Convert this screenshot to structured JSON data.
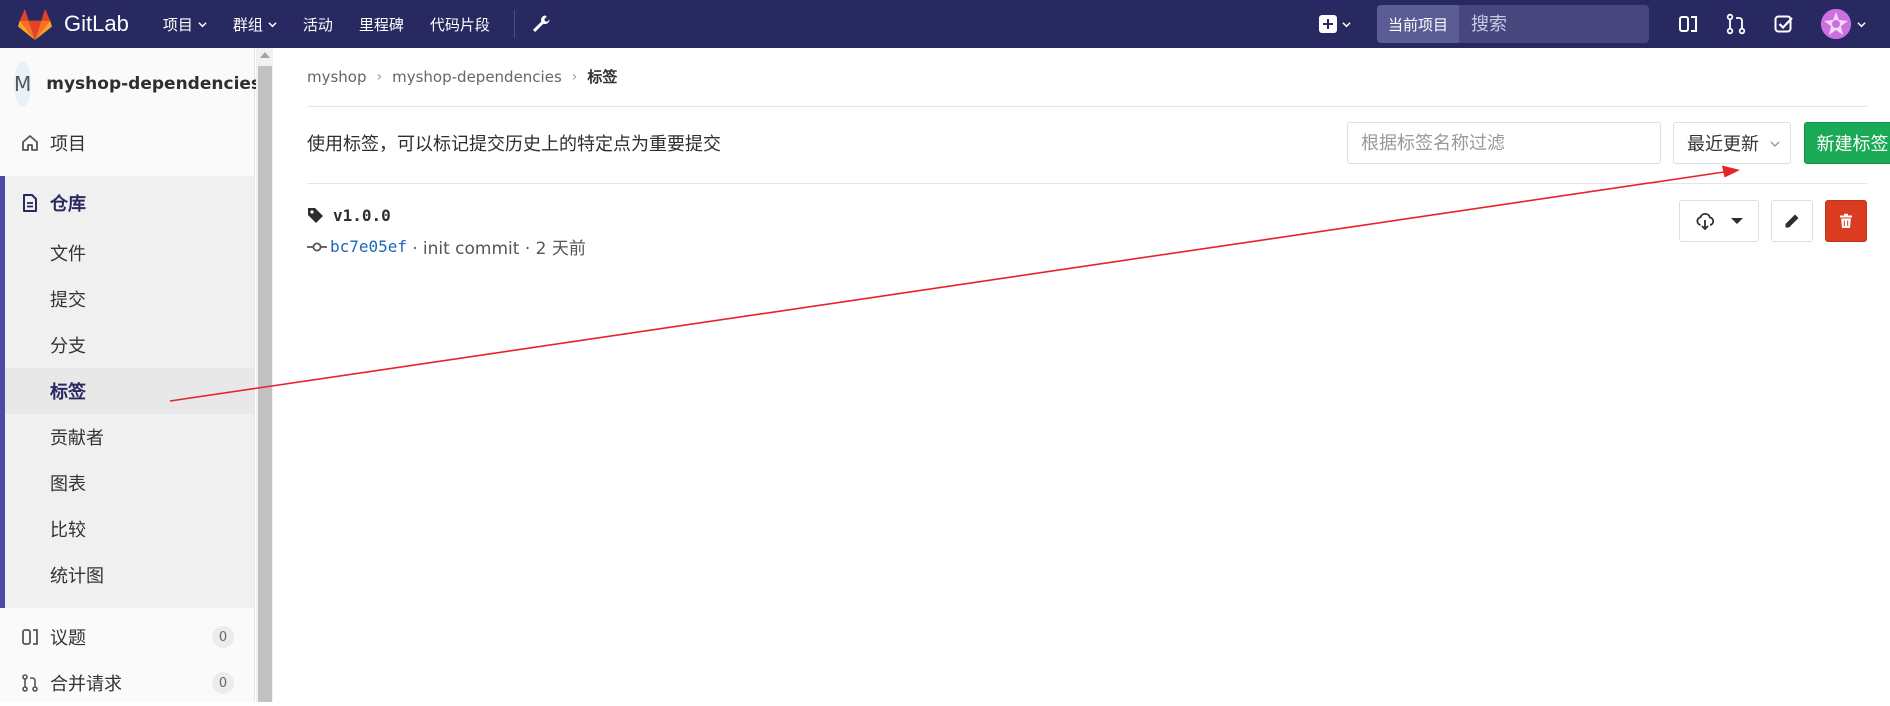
{
  "navbar": {
    "brand": "GitLab",
    "links": [
      {
        "label": "项目",
        "dropdown": true
      },
      {
        "label": "群组",
        "dropdown": true
      },
      {
        "label": "活动",
        "dropdown": false
      },
      {
        "label": "里程碑",
        "dropdown": false
      },
      {
        "label": "代码片段",
        "dropdown": false
      }
    ],
    "search_scope": "当前项目",
    "search_placeholder": "搜索"
  },
  "sidebar": {
    "project_initial": "M",
    "project_name": "myshop-dependencies",
    "project_label": "项目",
    "repo_label": "仓库",
    "repo_items": [
      "文件",
      "提交",
      "分支",
      "标签",
      "贡献者",
      "图表",
      "比较",
      "统计图"
    ],
    "active_item": "标签",
    "issues_label": "议题",
    "issues_count": "0",
    "mr_label": "合并请求",
    "mr_count": "0"
  },
  "breadcrumb": {
    "items": [
      "myshop",
      "myshop-dependencies"
    ],
    "current": "标签"
  },
  "main": {
    "description": "使用标签，可以标记提交历史上的特定点为重要提交",
    "filter_placeholder": "根据标签名称过滤",
    "sort_label": "最近更新",
    "new_tag_button": "新建标签"
  },
  "tags": [
    {
      "name": "v1.0.0",
      "sha": "bc7e05ef",
      "message": "· init commit · 2 天前"
    }
  ],
  "colors": {
    "navbar": "#292961",
    "success": "#1aaa55",
    "danger": "#db3b21",
    "link": "#1b69b6",
    "annotation_arrow": "#e8222a"
  }
}
